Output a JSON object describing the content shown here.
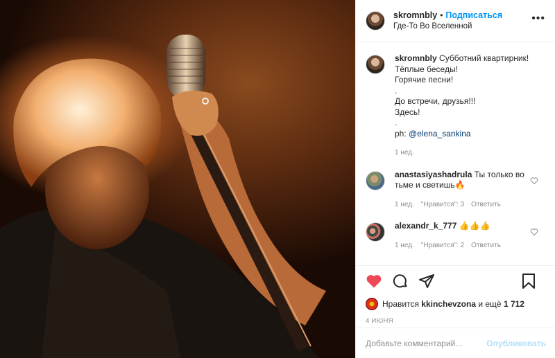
{
  "post": {
    "username": "skromnbly",
    "separator": "•",
    "follow_label": "Подписаться",
    "location": "Где-То Во Вселенной",
    "more_label": "•••"
  },
  "caption": {
    "username": "skromnbly",
    "lines": [
      "Субботний квартирник!",
      "Тёплые беседы!",
      "Горячие песни!",
      ".",
      "До встречи, друзья!!!",
      "Здесь!",
      "."
    ],
    "credit_prefix": "ph: ",
    "mention": "@elena_sankina",
    "time": "1 нед."
  },
  "comments": [
    {
      "username": "anastasiyashadrula",
      "text": "Ты только во тьме и светишь🔥",
      "time": "1 нед.",
      "likes": "\"Нравится\": 3",
      "reply": "Ответить"
    },
    {
      "username": "alexandr_k_777",
      "text": "👍👍👍",
      "time": "1 нед.",
      "likes": "\"Нравится\": 2",
      "reply": "Ответить"
    }
  ],
  "likes": {
    "prefix": "Нравится",
    "user": "kkinchevzona",
    "suffix": "и ещё",
    "count": "1 712"
  },
  "date": "4 ИЮНЯ",
  "add_comment": {
    "placeholder": "Добавьте комментарий...",
    "publish_label": "Опубликовать"
  },
  "colors": {
    "like_red": "#ed4956",
    "link_blue": "#0095f6",
    "muted": "#8e8e8e"
  },
  "icons": [
    "heart-icon",
    "comment-icon",
    "share-icon",
    "bookmark-icon",
    "more-icon"
  ]
}
